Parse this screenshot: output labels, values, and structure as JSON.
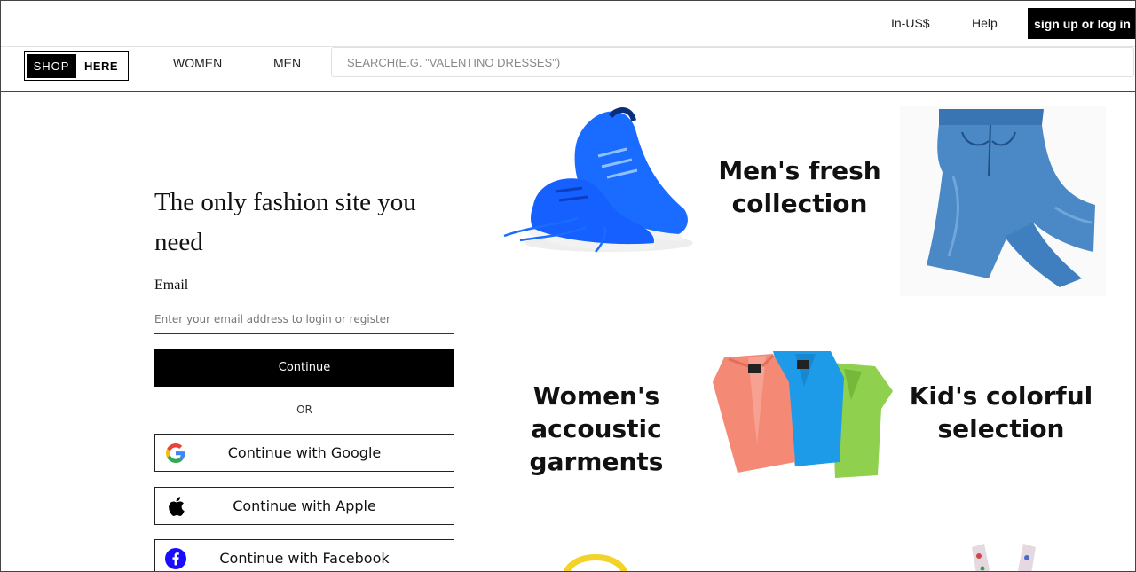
{
  "topbar": {
    "currency": "In-US$",
    "help": "Help",
    "signin": "sign up or log in"
  },
  "nav": {
    "logo_left": "SHOP",
    "logo_right": "HERE",
    "women": "WOMEN",
    "men": "MEN",
    "search_placeholder": "SEARCH(E.G. \"VALENTINO DRESSES\")"
  },
  "login": {
    "headline": "The only fashion site you need",
    "email_label": "Email",
    "email_placeholder": "Enter your email address to login or register",
    "continue_label": "Continue",
    "or_label": "OR",
    "google_label": "Continue with Google",
    "apple_label": "Continue with Apple",
    "facebook_label": "Continue with Facebook"
  },
  "promos": {
    "men": "Men's fresh collection",
    "women": "Women's accoustic garments",
    "kids": "Kid's colorful selection"
  },
  "icons": {
    "google": "google-icon",
    "apple": "apple-icon",
    "facebook": "facebook-icon"
  },
  "colors": {
    "primary": "#000000",
    "facebook": "#1a0dff",
    "shoe": "#1a6bff",
    "denim": "#3f7fbf"
  }
}
